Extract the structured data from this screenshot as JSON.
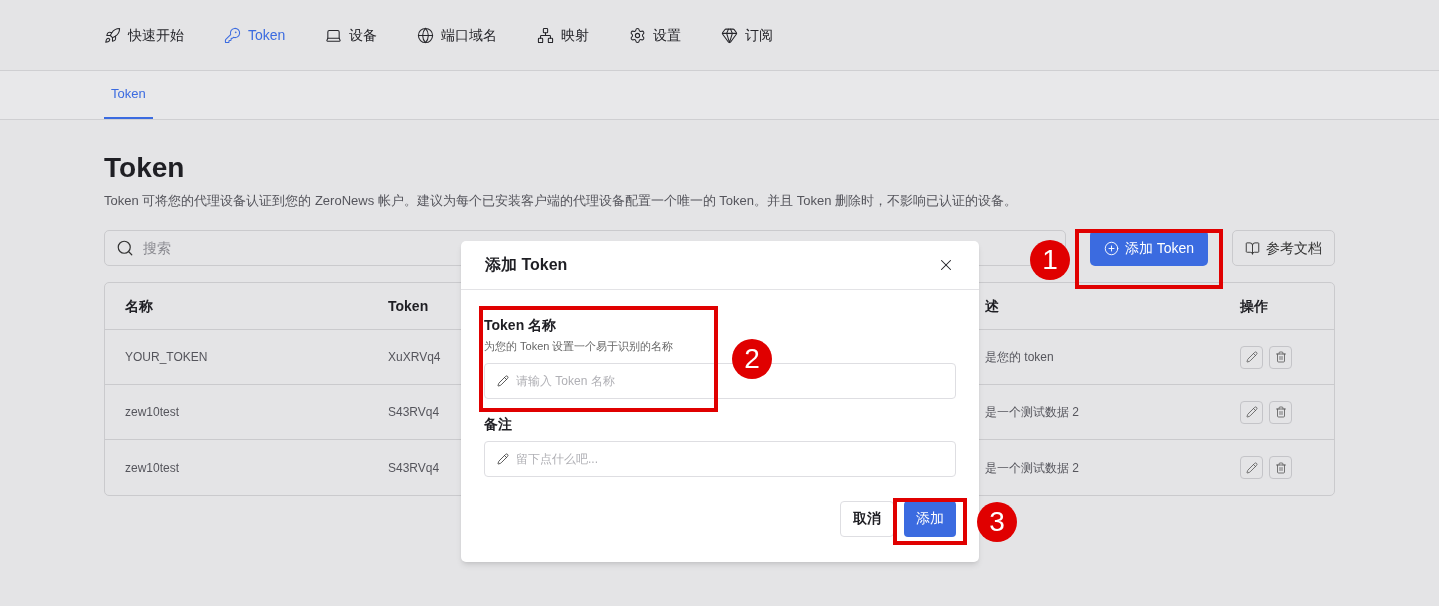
{
  "nav": [
    {
      "label": "快速开始",
      "selected": false
    },
    {
      "label": "Token",
      "selected": true
    },
    {
      "label": "设备",
      "selected": false
    },
    {
      "label": "端口域名",
      "selected": false
    },
    {
      "label": "映射",
      "selected": false
    },
    {
      "label": "设置",
      "selected": false
    },
    {
      "label": "订阅",
      "selected": false
    }
  ],
  "subtabs": [
    {
      "label": "Token",
      "selected": true
    }
  ],
  "page": {
    "title": "Token",
    "description": "Token 可将您的代理设备认证到您的 ZeroNews 帐户。建议为每个已安装客户端的代理设备配置一个唯一的 Token。并且 Token 删除时，不影响已认证的设备。"
  },
  "search": {
    "placeholder": "搜索"
  },
  "buttons": {
    "add": "添加 Token",
    "docs": "参考文档"
  },
  "table": {
    "columns": [
      "名称",
      "Token",
      "述",
      "操作"
    ],
    "rows": [
      {
        "name": "YOUR_TOKEN",
        "token": "XuXRVq4",
        "description": "是您的 token"
      },
      {
        "name": "zew10test",
        "token": "S43RVq4",
        "description": "是一个测试数据 2"
      },
      {
        "name": "zew10test",
        "token": "S43RVq4",
        "description": "是一个测试数据 2"
      }
    ]
  },
  "dialog": {
    "title": "添加 Token",
    "fields": [
      {
        "label": "Token 名称",
        "hint": "为您的 Token 设置一个易于识别的名称",
        "placeholder": "请输入 Token 名称"
      },
      {
        "label": "备注",
        "placeholder": "留下点什么吧..."
      }
    ],
    "cancel": "取消",
    "submit": "添加"
  },
  "annotations": [
    {
      "label": "1"
    },
    {
      "label": "2"
    },
    {
      "label": "3"
    }
  ]
}
